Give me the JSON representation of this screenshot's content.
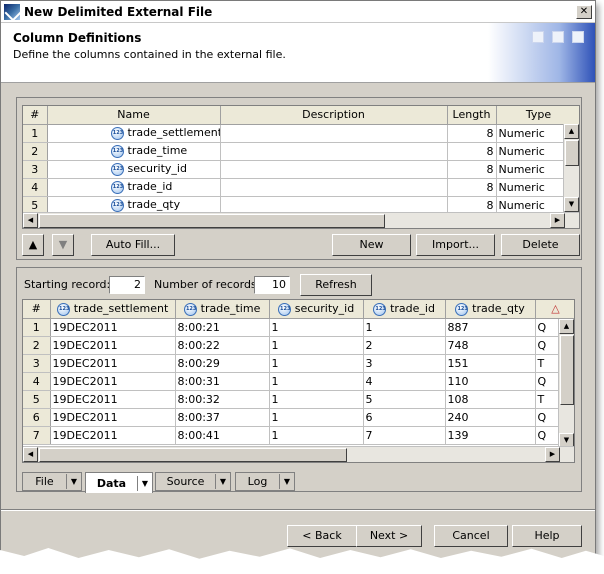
{
  "window": {
    "title": "New Delimited External File",
    "close_glyph": "✕"
  },
  "header": {
    "title": "Column Definitions",
    "subtitle": "Define the columns contained in the external file."
  },
  "columns_grid": {
    "headers": [
      "#",
      "Name",
      "Description",
      "Length",
      "Type"
    ],
    "rows": [
      {
        "num": "1",
        "name": "trade_settlement",
        "description": "",
        "length": "8",
        "type": "Numeric"
      },
      {
        "num": "2",
        "name": "trade_time",
        "description": "",
        "length": "8",
        "type": "Numeric"
      },
      {
        "num": "3",
        "name": "security_id",
        "description": "",
        "length": "8",
        "type": "Numeric"
      },
      {
        "num": "4",
        "name": "trade_id",
        "description": "",
        "length": "8",
        "type": "Numeric"
      },
      {
        "num": "5",
        "name": "trade_qty",
        "description": "",
        "length": "8",
        "type": "Numeric"
      }
    ]
  },
  "toolbar": {
    "up_glyph": "▲",
    "down_glyph": "▼",
    "autofill_label": "Auto Fill...",
    "new_label": "New",
    "import_label": "Import...",
    "delete_label": "Delete"
  },
  "preview": {
    "starting_record_label": "Starting record:",
    "starting_record_value": "2",
    "number_of_records_label": "Number of records:",
    "number_of_records_value": "10",
    "refresh_label": "Refresh",
    "headers": [
      "#",
      "trade_settlement",
      "trade_time",
      "security_id",
      "trade_id",
      "trade_qty"
    ],
    "rows": [
      {
        "num": "1",
        "cells": [
          "19DEC2011",
          "8:00:21",
          "1",
          "1",
          "887",
          "Q"
        ]
      },
      {
        "num": "2",
        "cells": [
          "19DEC2011",
          "8:00:22",
          "1",
          "2",
          "748",
          "Q"
        ]
      },
      {
        "num": "3",
        "cells": [
          "19DEC2011",
          "8:00:29",
          "1",
          "3",
          "151",
          "T"
        ]
      },
      {
        "num": "4",
        "cells": [
          "19DEC2011",
          "8:00:31",
          "1",
          "4",
          "110",
          "Q"
        ]
      },
      {
        "num": "5",
        "cells": [
          "19DEC2011",
          "8:00:32",
          "1",
          "5",
          "108",
          "T"
        ]
      },
      {
        "num": "6",
        "cells": [
          "19DEC2011",
          "8:00:37",
          "1",
          "6",
          "240",
          "Q"
        ]
      },
      {
        "num": "7",
        "cells": [
          "19DEC2011",
          "8:00:41",
          "1",
          "7",
          "139",
          "Q"
        ]
      }
    ]
  },
  "tabs": [
    {
      "label": "File",
      "active": false
    },
    {
      "label": "Data",
      "active": true
    },
    {
      "label": "Source",
      "active": false
    },
    {
      "label": "Log",
      "active": false
    }
  ],
  "footer": {
    "back_label": "< Back",
    "next_label": "Next >",
    "cancel_label": "Cancel",
    "help_label": "Help"
  }
}
